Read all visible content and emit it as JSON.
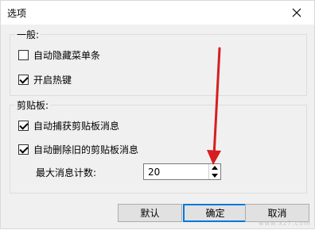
{
  "window": {
    "title": "选项"
  },
  "groups": {
    "general": {
      "label": "一般:",
      "options": [
        {
          "label": "自动隐藏菜单条",
          "checked": false
        },
        {
          "label": "开启热键",
          "checked": true
        }
      ]
    },
    "clipboard": {
      "label": "剪贴板:",
      "options": [
        {
          "label": "自动捕获剪贴板消息",
          "checked": true
        },
        {
          "label": "自动删除旧的剪贴板消息",
          "checked": true
        }
      ],
      "max_label": "最大消息计数:",
      "max_value": "20"
    }
  },
  "buttons": {
    "default": "默认",
    "ok": "确定",
    "cancel": "取消"
  },
  "watermark": "www.xz7.com",
  "colors": {
    "arrow": "#d61f1f",
    "focus_border": "#0078d7"
  }
}
